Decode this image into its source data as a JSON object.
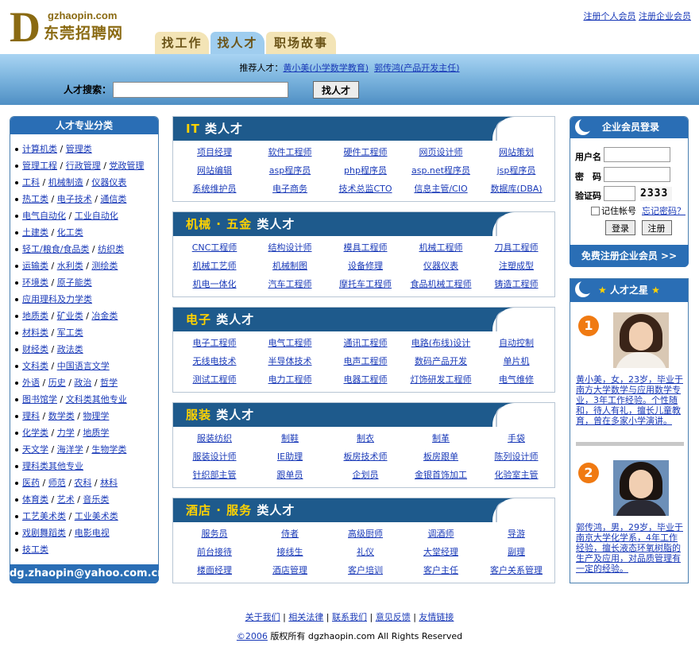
{
  "logo": {
    "domain": "gzhaopin.com",
    "letter": "D",
    "name": "东莞招聘网"
  },
  "toplinks": [
    "注册个人会员",
    "注册企业会员"
  ],
  "tabs": [
    "找工作",
    "找人才",
    "职场故事"
  ],
  "recommend": {
    "label": "推荐人才：",
    "people": [
      "黄小美(小学数学教育)",
      "郭传鸿(产品开发主任)"
    ]
  },
  "search": {
    "label": "人才搜索：",
    "button": "找人才",
    "value": ""
  },
  "sidebar": {
    "title": "人才专业分类",
    "items": [
      [
        "计算机类",
        "管理类"
      ],
      [
        "管理工程",
        "行政管理",
        "党政管理"
      ],
      [
        "工科",
        "机械制造",
        "仪器仪表"
      ],
      [
        "热工类",
        "电子技术",
        "通信类"
      ],
      [
        "电气自动化",
        "工业自动化"
      ],
      [
        "土建类",
        "化工类"
      ],
      [
        "轻工/粮食/食品类",
        "纺织类"
      ],
      [
        "运输类",
        "水利类",
        "测绘类"
      ],
      [
        "环境类",
        "原子能类"
      ],
      [
        "应用理科及力学类"
      ],
      [
        "地质类",
        "矿业类",
        "冶金类"
      ],
      [
        "材料类",
        "军工类"
      ],
      [
        "财经类",
        "政法类"
      ],
      [
        "文科类",
        "中国语言文学"
      ],
      [
        "外语",
        "历史",
        "政治",
        "哲学"
      ],
      [
        "图书馆学",
        "文科类其他专业"
      ],
      [
        "理科",
        "数学类",
        "物理学"
      ],
      [
        "化学类",
        "力学",
        "地质学"
      ],
      [
        "天文学",
        "海洋学",
        "生物学类"
      ],
      [
        "理科类其他专业"
      ],
      [
        "医药",
        "师范",
        "农科",
        "林科"
      ],
      [
        "体育类",
        "艺术",
        "音乐类"
      ],
      [
        "工艺美术类",
        "工业美术类"
      ],
      [
        "戏剧舞蹈类",
        "电影电视"
      ],
      [
        "技工类"
      ]
    ],
    "email": "dg.zhaopin@yahoo.com.cn"
  },
  "sections": [
    {
      "hl": "IT",
      "rest": " 类人才",
      "rows": [
        [
          "项目经理",
          "软件工程师",
          "硬件工程师",
          "网页设计师",
          "网站策划"
        ],
        [
          "网站编辑",
          "asp程序员",
          "php程序员",
          "asp.net程序员",
          "jsp程序员"
        ],
        [
          "系统维护员",
          "电子商务",
          "技术总监CTO",
          "信息主管/CIO",
          "数据库(DBA)"
        ]
      ]
    },
    {
      "hl": "机械 · 五金",
      "rest": " 类人才",
      "rows": [
        [
          "CNC工程师",
          "结构设计师",
          "模具工程师",
          "机械工程师",
          "刀具工程师"
        ],
        [
          "机械工艺师",
          "机械制图",
          "设备修理",
          "仪器仪表",
          "注塑成型"
        ],
        [
          "机电一体化",
          "汽车工程师",
          "摩托车工程师",
          "食品机械工程师",
          "铸造工程师"
        ]
      ]
    },
    {
      "hl": "电子",
      "rest": " 类人才",
      "rows": [
        [
          "电子工程师",
          "电气工程师",
          "通讯工程师",
          "电路(布线)设计",
          "自动控制"
        ],
        [
          "无线电技术",
          "半导体技术",
          "电声工程师",
          "数码产品开发",
          "单片机"
        ],
        [
          "测试工程师",
          "电力工程师",
          "电器工程师",
          "灯饰研发工程师",
          "电气维修"
        ]
      ]
    },
    {
      "hl": "服装",
      "rest": " 类人才",
      "rows": [
        [
          "服装纺织",
          "制鞋",
          "制衣",
          "制革",
          "手袋"
        ],
        [
          "服装设计师",
          "IE助理",
          "板房技术师",
          "板房跟单",
          "陈列设计师"
        ],
        [
          "针织部主管",
          "跟单员",
          "企划员",
          "金银首饰加工",
          "化验室主管"
        ]
      ]
    },
    {
      "hl": "酒店 · 服务",
      "rest": " 类人才",
      "rows": [
        [
          "服务员",
          "侍者",
          "高级厨师",
          "调酒师",
          "导游"
        ],
        [
          "前台接待",
          "接线生",
          "礼仪",
          "大堂经理",
          "副理"
        ],
        [
          "楼面经理",
          "酒店管理",
          "客户培训",
          "客户主任",
          "客户关系管理"
        ]
      ]
    }
  ],
  "login": {
    "title": "企业会员登录",
    "username_label": "用户名",
    "password_label": "密　码",
    "captcha_label": "验证码",
    "captcha_text": "2333",
    "remember_label": "记住帐号",
    "forgot_label": "忘记密码？",
    "login_button": "登录",
    "register_button": "注册",
    "free_register": "免费注册企业会员 >>"
  },
  "stars": {
    "title_pre": "★",
    "title": " 人才之星 ",
    "title_post": "★",
    "items": [
      {
        "rank": "1",
        "desc": "黄小美，女，23岁，毕业于南方大学数学与应用数学专业，3年工作经验。个性随和，待人有礼，擅长儿童教育，曾在多家小学演讲。"
      },
      {
        "rank": "2",
        "desc": "郭传鸿，男，29岁，毕业于南京大学化学系，4年工作经验，擅长液态环氧树脂的生产及应用，对品质管理有一定的经验。"
      }
    ]
  },
  "footer": {
    "links": [
      "关于我们",
      "相关法律",
      "联系我们",
      "意见反馈",
      "友情链接"
    ],
    "copy_year": "©2006",
    "copy_text": " 版权所有 dgzhaopin.com All Rights Reserved"
  },
  "colors": {
    "primary": "#2a6eb5",
    "section_header": "#1e5a8c",
    "highlight": "#ffd200",
    "link": "#1a3ab8",
    "tab": "#f3e4b6"
  }
}
